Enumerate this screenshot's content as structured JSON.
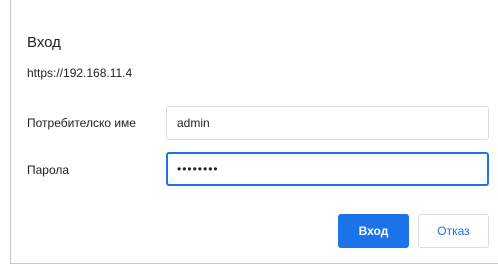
{
  "dialog": {
    "title": "Вход",
    "origin": "https://192.168.11.4",
    "username_label": "Потребителско име",
    "username_value": "admin",
    "password_label": "Парола",
    "password_masked": "••••••••",
    "ok_label": "Вход",
    "cancel_label": "Отказ"
  },
  "colors": {
    "accent": "#1a73e8",
    "border": "#dadce0",
    "text": "#202124"
  }
}
